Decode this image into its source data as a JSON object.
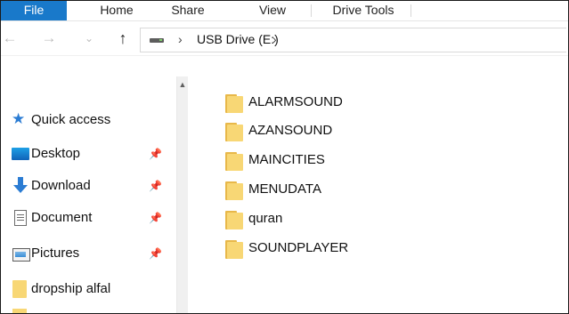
{
  "ribbon": {
    "tabs": [
      {
        "label": "File"
      },
      {
        "label": "Home"
      },
      {
        "label": "Share"
      },
      {
        "label": "View"
      },
      {
        "label": "Drive Tools"
      }
    ]
  },
  "navigation": {
    "back_glyph": "←",
    "forward_glyph": "→",
    "recent_glyph": "⌄",
    "up_glyph": "↑"
  },
  "address": {
    "separator_glyph": "›",
    "current_location": "USB Drive (E:)"
  },
  "nav_pane": {
    "scroll_up_glyph": "▲",
    "pin_glyph": "📌",
    "items": [
      {
        "label": "Quick access",
        "icon": "star-icon"
      },
      {
        "label": "Desktop",
        "icon": "desktop-icon",
        "pinned": true
      },
      {
        "label": "Download",
        "icon": "download-icon",
        "pinned": true
      },
      {
        "label": "Document",
        "icon": "documents-icon",
        "pinned": true
      },
      {
        "label": "Pictures",
        "icon": "pictures-icon",
        "pinned": true
      },
      {
        "label": "dropship alfal",
        "icon": "folder-icon",
        "pinned": false
      }
    ]
  },
  "files": [
    {
      "name": "ALARMSOUND"
    },
    {
      "name": "AZANSOUND"
    },
    {
      "name": "MAINCITIES"
    },
    {
      "name": "MENUDATA"
    },
    {
      "name": "quran"
    },
    {
      "name": "SOUNDPLAYER"
    }
  ],
  "colors": {
    "accent": "#1979ca",
    "folder": "#f8d775",
    "quick_access_star": "#2b7cd3"
  }
}
